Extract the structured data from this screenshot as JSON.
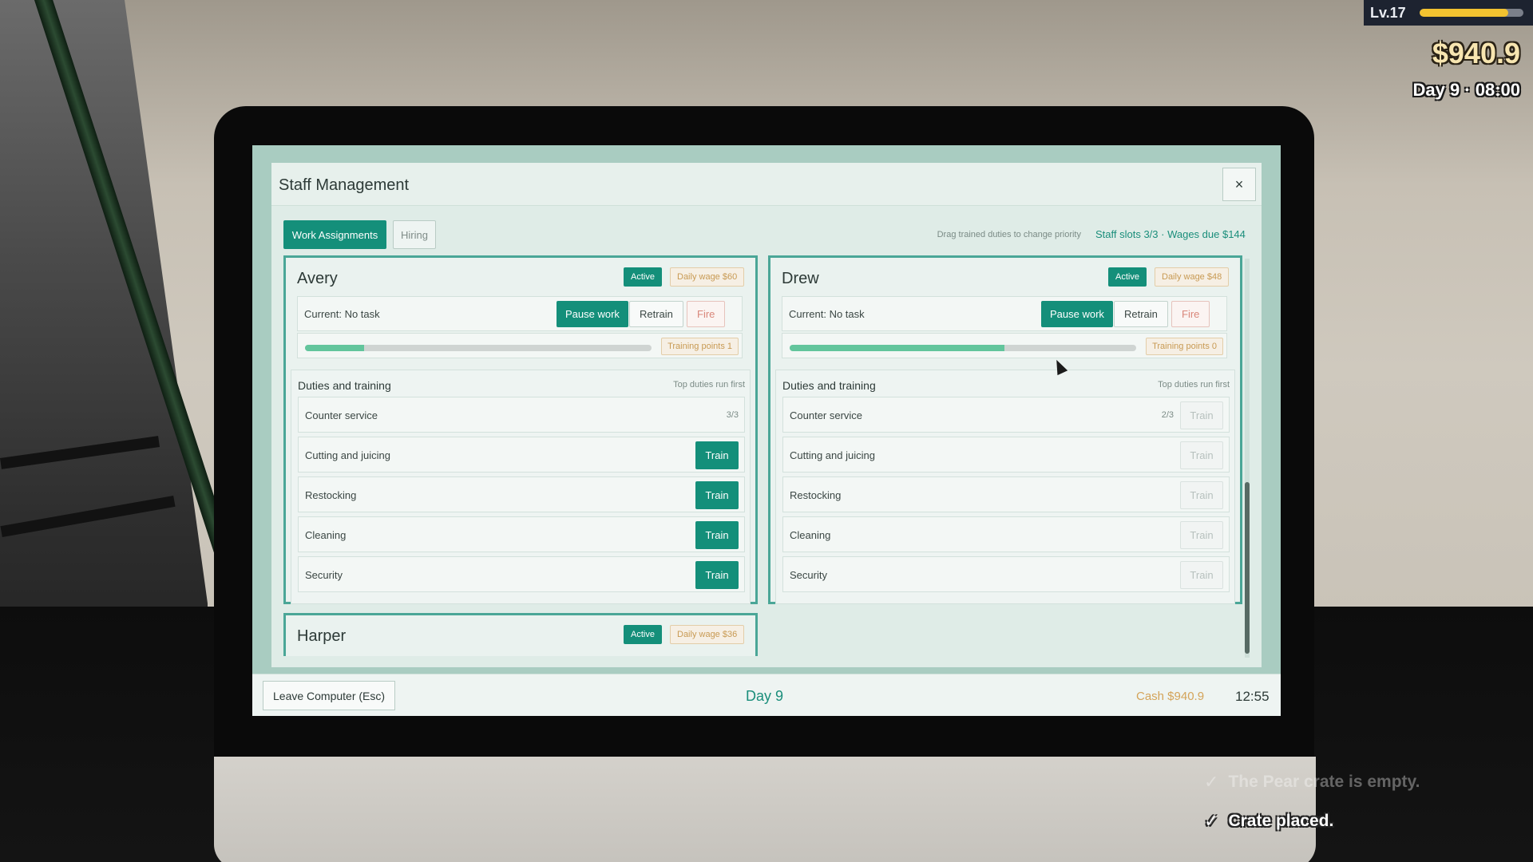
{
  "hud": {
    "level": "Lv.17",
    "xp_progress": 0.85,
    "cash": "$940.9",
    "day_time": "Day 9 · 08:00"
  },
  "window": {
    "title": "Staff Management",
    "close_label": "×",
    "tabs": [
      {
        "label": "Work Assignments",
        "active": true
      },
      {
        "label": "Hiring",
        "active": false
      }
    ],
    "hint": "Drag trained duties to change priority",
    "slots_wages": "Staff slots 3/3 · Wages due $144"
  },
  "staff": [
    {
      "name": "Avery",
      "status": "Active",
      "wage": "Daily wage $60",
      "current": "Current: No task",
      "pause_label": "Pause work",
      "retrain_label": "Retrain",
      "fire_label": "Fire",
      "progress": 0.17,
      "points": "Training points 1",
      "duties_title": "Duties and training",
      "duties_sub": "Top duties run first",
      "duties": [
        {
          "label": "Counter service",
          "level": "3/3",
          "train": null
        },
        {
          "label": "Cutting and juicing",
          "level": "",
          "train": "Train"
        },
        {
          "label": "Restocking",
          "level": "",
          "train": "Train"
        },
        {
          "label": "Cleaning",
          "level": "",
          "train": "Train"
        },
        {
          "label": "Security",
          "level": "",
          "train": "Train"
        }
      ]
    },
    {
      "name": "Drew",
      "status": "Active",
      "wage": "Daily wage $48",
      "current": "Current: No task",
      "pause_label": "Pause work",
      "retrain_label": "Retrain",
      "fire_label": "Fire",
      "progress": 0.62,
      "points": "Training points 0",
      "duties_title": "Duties and training",
      "duties_sub": "Top duties run first",
      "duties": [
        {
          "label": "Counter service",
          "level": "2/3",
          "train": "Train"
        },
        {
          "label": "Cutting and juicing",
          "level": "",
          "train": "Train"
        },
        {
          "label": "Restocking",
          "level": "",
          "train": "Train"
        },
        {
          "label": "Cleaning",
          "level": "",
          "train": "Train"
        },
        {
          "label": "Security",
          "level": "",
          "train": "Train"
        }
      ]
    },
    {
      "name": "Harper",
      "status": "Active",
      "wage": "Daily wage $36"
    }
  ],
  "footer": {
    "leave_label": "Leave Computer (Esc)",
    "day": "Day 9",
    "cash": "Cash $940.9",
    "time": "12:55"
  },
  "notifications": [
    {
      "text": "The Pear crate is empty.",
      "faded": true
    },
    {
      "text": "Crate placed.",
      "faded": false
    }
  ],
  "colors": {
    "accent": "#148f7a",
    "wage": "#c89a53",
    "fire": "#d9867a"
  }
}
